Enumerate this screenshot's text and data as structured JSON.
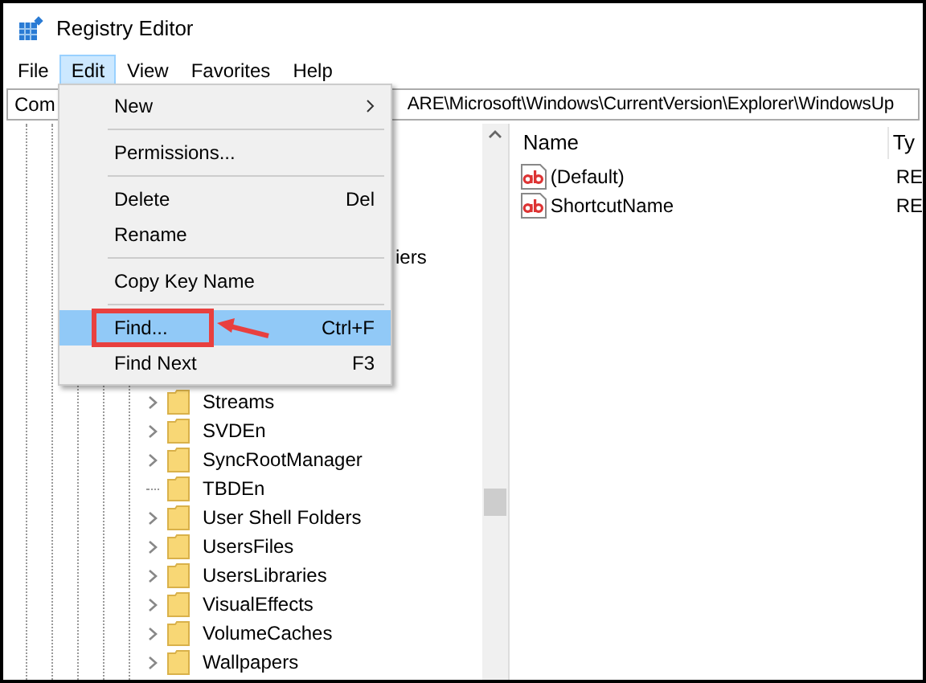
{
  "window": {
    "title": "Registry Editor"
  },
  "menu_bar": [
    {
      "label": "File",
      "selected": false
    },
    {
      "label": "Edit",
      "selected": true
    },
    {
      "label": "View",
      "selected": false
    },
    {
      "label": "Favorites",
      "selected": false
    },
    {
      "label": "Help",
      "selected": false
    }
  ],
  "address": {
    "start": "Com",
    "end": "ARE\\Microsoft\\Windows\\CurrentVersion\\Explorer\\WindowsUp"
  },
  "tree": {
    "partial_label": "iers",
    "items": [
      {
        "label": "Streams",
        "expandable": true
      },
      {
        "label": "SVDEn",
        "expandable": true
      },
      {
        "label": "SyncRootManager",
        "expandable": true
      },
      {
        "label": "TBDEn",
        "expandable": false
      },
      {
        "label": "User Shell Folders",
        "expandable": true
      },
      {
        "label": "UsersFiles",
        "expandable": true
      },
      {
        "label": "UsersLibraries",
        "expandable": true
      },
      {
        "label": "VisualEffects",
        "expandable": true
      },
      {
        "label": "VolumeCaches",
        "expandable": true
      },
      {
        "label": "Wallpapers",
        "expandable": true
      }
    ]
  },
  "values": {
    "columns": [
      "Name",
      "Ty"
    ],
    "rows": [
      {
        "name": "(Default)",
        "type": "RE"
      },
      {
        "name": "ShortcutName",
        "type": "RE"
      }
    ]
  },
  "edit_menu": [
    {
      "kind": "item",
      "label": "New",
      "submenu": true,
      "selected": false
    },
    {
      "kind": "separator"
    },
    {
      "kind": "item",
      "label": "Permissions...",
      "selected": false
    },
    {
      "kind": "separator"
    },
    {
      "kind": "item",
      "label": "Delete",
      "shortcut": "Del",
      "selected": false
    },
    {
      "kind": "item",
      "label": "Rename",
      "selected": false
    },
    {
      "kind": "separator"
    },
    {
      "kind": "item",
      "label": "Copy Key Name",
      "selected": false
    },
    {
      "kind": "separator"
    },
    {
      "kind": "item",
      "label": "Find...",
      "shortcut": "Ctrl+F",
      "selected": true,
      "annotated": true
    },
    {
      "kind": "item",
      "label": "Find Next",
      "shortcut": "F3",
      "selected": false
    }
  ]
}
